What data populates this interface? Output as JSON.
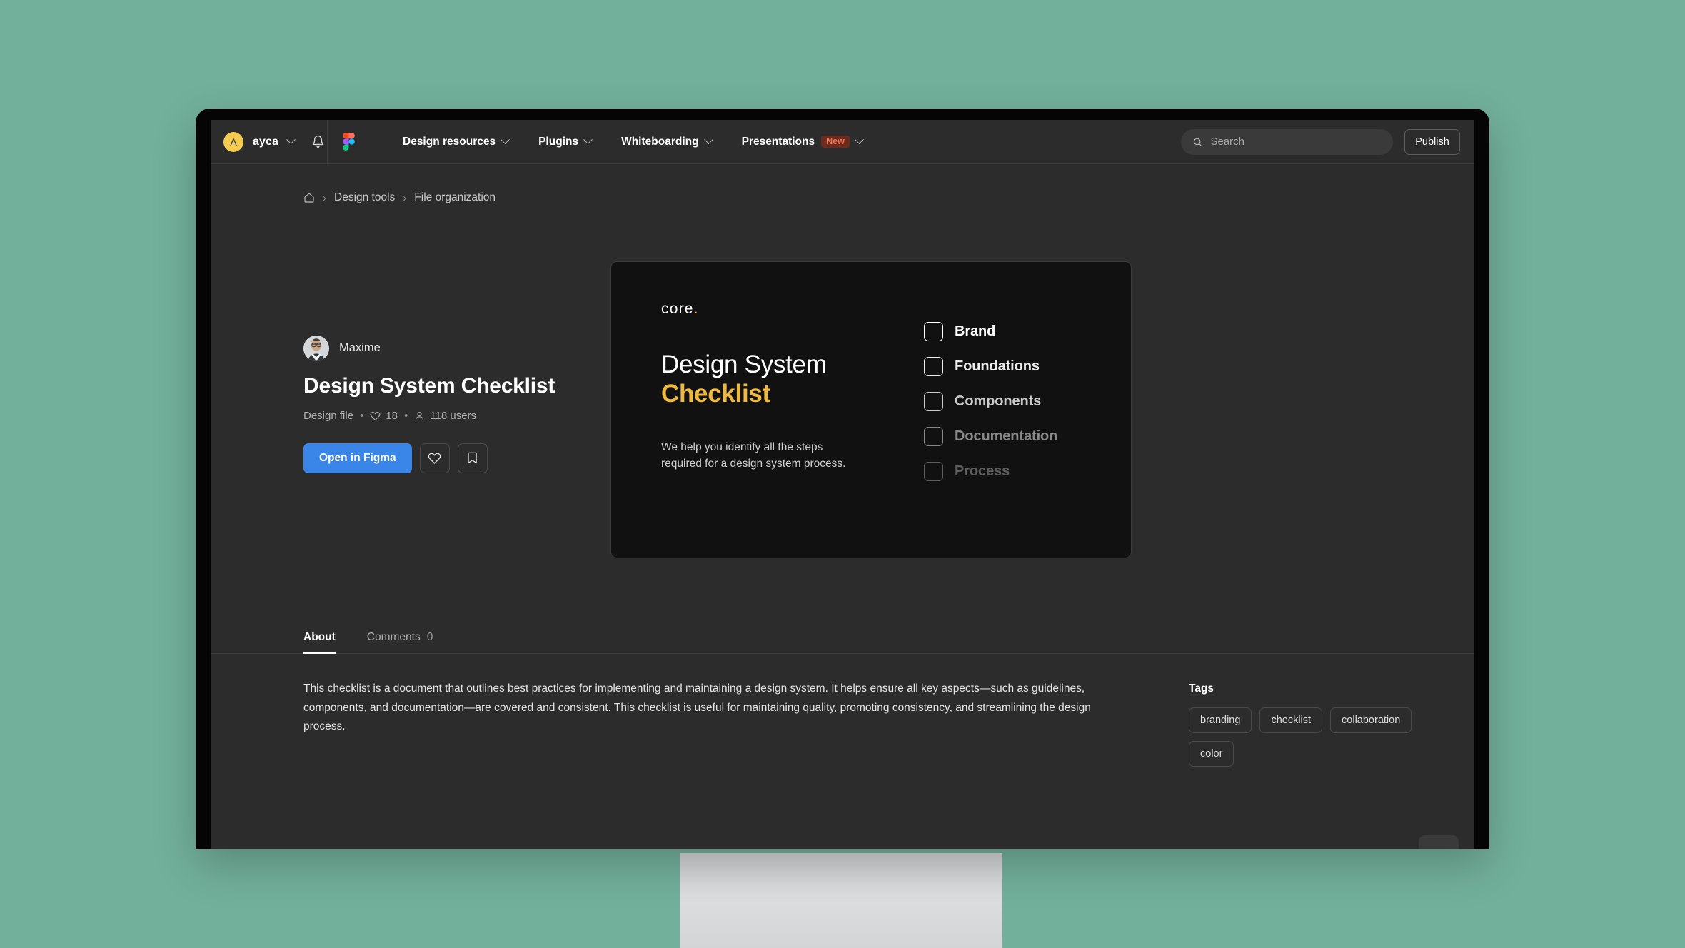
{
  "nav": {
    "account_initial": "A",
    "account_name": "ayca",
    "notifications_icon": "bell-icon",
    "brand_icon": "figma-logo-icon",
    "menu": [
      {
        "label": "Design resources",
        "badge": ""
      },
      {
        "label": "Plugins",
        "badge": ""
      },
      {
        "label": "Whiteboarding",
        "badge": ""
      },
      {
        "label": "Presentations",
        "badge": "New"
      }
    ],
    "search_placeholder": "Search",
    "search_value": "",
    "publish_label": "Publish"
  },
  "breadcrumb": {
    "home_icon": "home-icon",
    "items": [
      {
        "label": "Design tools"
      },
      {
        "label": "File organization"
      }
    ],
    "separator": "›"
  },
  "file": {
    "author": "Maxime",
    "title": "Design System Checklist",
    "type": "Design file",
    "likes": "18",
    "users": "118 users",
    "separator": "•",
    "primary_action": "Open in Figma",
    "like_icon": "heart-icon",
    "save_icon": "bookmark-icon"
  },
  "preview": {
    "brand": "core",
    "brand_dot": ".",
    "heading_line1": "Design System",
    "heading_line2": "Checklist",
    "subtitle_line1": "We help you identify all the steps",
    "subtitle_line2": "required for a design system process.",
    "checklist": [
      {
        "label": "Brand",
        "opacity": "1"
      },
      {
        "label": "Foundations",
        "opacity": "0.92"
      },
      {
        "label": "Components",
        "opacity": "0.78"
      },
      {
        "label": "Documentation",
        "opacity": "0.5"
      },
      {
        "label": "Process",
        "opacity": "0.32"
      }
    ],
    "accent_color": "#efb93f"
  },
  "tabs": [
    {
      "label": "About",
      "count": "",
      "active": true
    },
    {
      "label": "Comments",
      "count": "0",
      "active": false
    }
  ],
  "about": {
    "description": "This checklist is a document that outlines best practices for implementing and maintaining a design system. It helps ensure all key aspects—such as guidelines, components, and documentation—are covered and consistent. This checklist is useful for maintaining quality, promoting consistency, and streamlining the design process.",
    "tags_title": "Tags",
    "tags": [
      "branding",
      "checklist",
      "collaboration",
      "color"
    ]
  },
  "theme": {
    "page_background": "#72b09b",
    "screen_background": "#2c2c2c",
    "card_background": "#111111",
    "primary_button": "#3a85e8",
    "accent_yellow": "#efb93f",
    "avatar_yellow": "#f2cb4f"
  }
}
